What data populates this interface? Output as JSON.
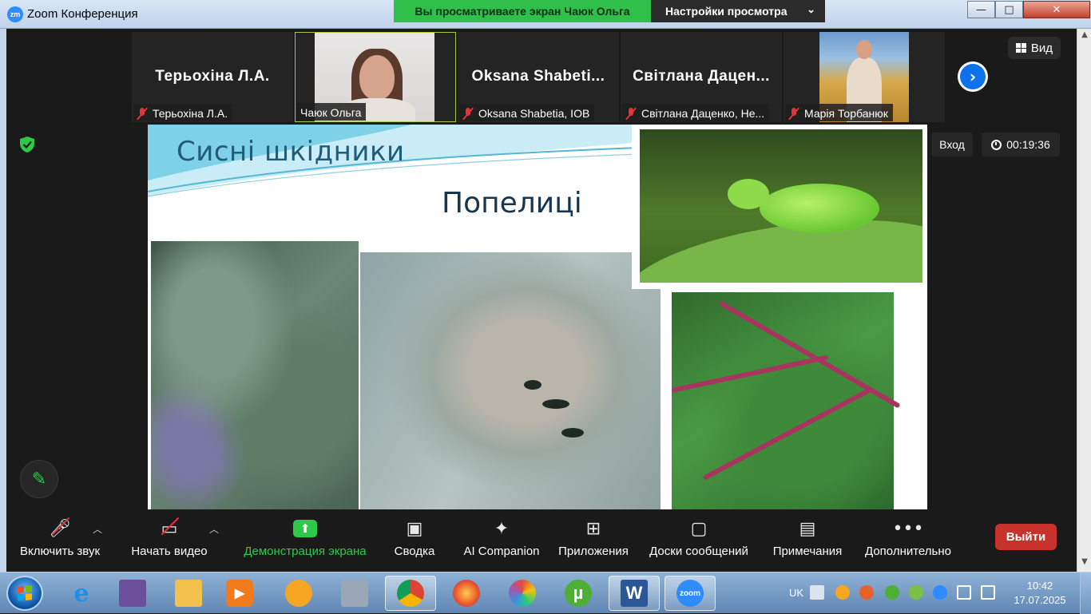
{
  "window": {
    "app_icon_text": "zm",
    "title": "Zoom Конференция",
    "share_banner": "Вы просматриваете экран Чаюк Ольга",
    "view_options": "Настройки просмотра",
    "btn_minimize": "—",
    "btn_maximize": "□",
    "btn_close": "✕"
  },
  "filmstrip": {
    "tiles": [
      {
        "big_name": "Терьохіна Л.А.",
        "label": "Терьохіна Л.А.",
        "muted": true
      },
      {
        "big_name": "",
        "label": "Чаюк Ольга",
        "muted": false
      },
      {
        "big_name": "Oksana  Shabeti...",
        "label": "Oksana Shabetia, IOB",
        "muted": true
      },
      {
        "big_name": "Світлана  Дацен...",
        "label": "Світлана Даценко, Не...",
        "muted": true
      },
      {
        "big_name": "",
        "label": "Марія Торбанюк",
        "muted": true
      }
    ],
    "view_button": "Вид"
  },
  "meeting": {
    "enter_label": "Вход",
    "timer": "00:19:36"
  },
  "slide": {
    "title": "Сисні шкідники",
    "subtitle": "Попелиці"
  },
  "toolbar": {
    "items": [
      {
        "label": "Включить звук",
        "icon": "mic-muted-icon"
      },
      {
        "label": "Начать видео",
        "icon": "video-off-icon"
      },
      {
        "label": "Демонстрация экрана",
        "icon": "share-screen-icon"
      },
      {
        "label": "Сводка",
        "icon": "summary-icon"
      },
      {
        "label": "AI Companion",
        "icon": "ai-sparkle-icon"
      },
      {
        "label": "Приложения",
        "icon": "apps-icon"
      },
      {
        "label": "Доски сообщений",
        "icon": "whiteboard-icon"
      },
      {
        "label": "Примечания",
        "icon": "notes-icon"
      },
      {
        "label": "Дополнительно",
        "icon": "more-icon"
      }
    ],
    "leave_label": "Выйти"
  },
  "taskbar": {
    "apps": [
      "ie-icon",
      "save-icon",
      "folder-icon",
      "media-player-icon",
      "vpn-icon",
      "calculator-icon",
      "chrome-icon",
      "firefox-icon",
      "picasa-icon",
      "utorrent-icon",
      "word-icon",
      "zoom-icon"
    ],
    "word_glyph": "W",
    "zoom_glyph": "zoom",
    "utorrent_glyph": "µ",
    "language": "UK",
    "time": "10:42",
    "date": "17.07.2025"
  },
  "colors": {
    "share_green": "#2fbf4a",
    "leave_red": "#c7332c",
    "zoom_blue": "#0e72ed",
    "muted_red": "#e0353b"
  }
}
